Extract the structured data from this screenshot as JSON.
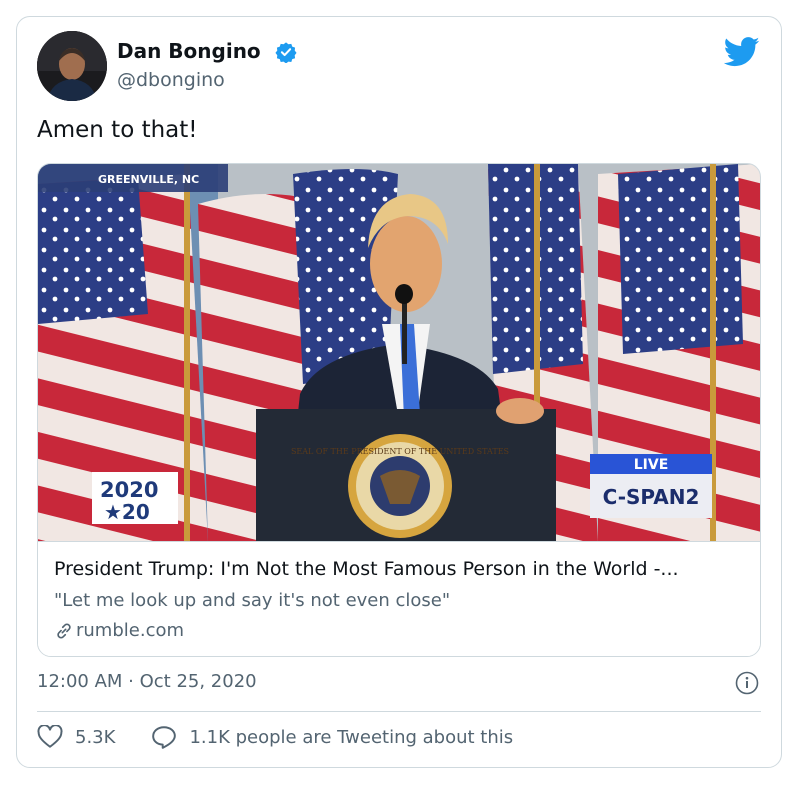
{
  "author": {
    "name": "Dan Bongino",
    "handle": "@dbongino"
  },
  "tweet": {
    "text": "Amen to that!",
    "timestamp": "12:00 AM · Oct 25, 2020"
  },
  "media": {
    "location_label": "GREENVILLE, NC",
    "logo_top": "2020",
    "logo_bottom": "★20",
    "live_label": "LIVE",
    "network_label": "C-SPAN2",
    "seal_text": "SEAL OF THE PRESIDENT OF THE UNITED STATES"
  },
  "link_card": {
    "title": "President Trump: I'm Not the Most Famous Person in the World -...",
    "description": "\"Let me look up and say it's not even close\"",
    "domain": "rumble.com"
  },
  "actions": {
    "likes": "5.3K",
    "tweeting": "1.1K people are Tweeting about this"
  },
  "icons": [
    "verified-icon",
    "twitter-bird-icon",
    "link-icon",
    "info-icon",
    "heart-icon",
    "reply-bubble-icon"
  ],
  "colors": {
    "accent": "#1d9bf0",
    "muted": "#536471",
    "border": "#cfd9de"
  }
}
